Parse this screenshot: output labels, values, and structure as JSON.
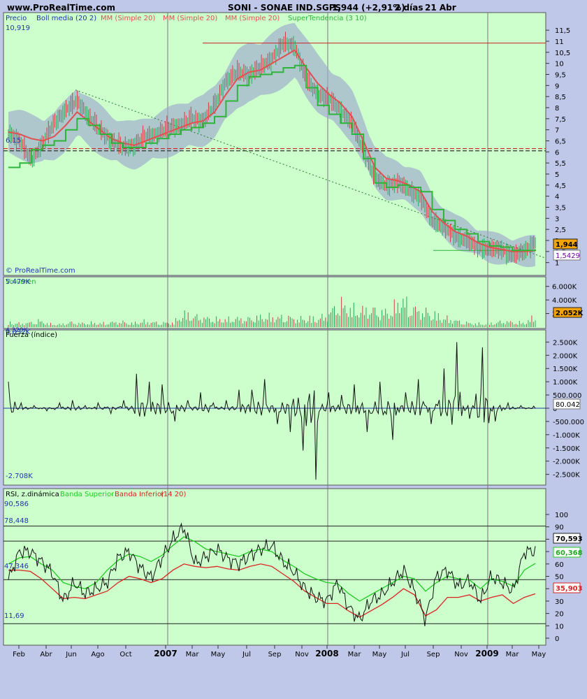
{
  "header": {
    "site": "www.ProRealTime.com",
    "ticker": "SONI - SONAE IND.SGPS",
    "quote": "1,944 (+2,91%)",
    "period": "2 días",
    "date": "21 Abr"
  },
  "colors": {
    "panel_bg": "#ccffcc",
    "page_bg": "#bfc8e9",
    "candle_up": "#27a85a",
    "candle_down": "#d23c46",
    "mm": "#e05050",
    "supertrend": "#2fb43a",
    "boll_band": "#9ea9cc",
    "rsi_line": "#111111",
    "band_superior": "#22cc22",
    "band_inferior": "#dd2222"
  },
  "watermark": "© ProRealTime.com",
  "x_axis_labels": [
    "Feb",
    "Abr",
    "Jun",
    "Ago",
    "Oct",
    "2007",
    "Mar",
    "May",
    "Jul",
    "Sep",
    "Nov",
    "2008",
    "Mar",
    "May",
    "Jul",
    "Sep",
    "Nov",
    "2009",
    "Mar",
    "May"
  ],
  "price_panel": {
    "legend": [
      "Precio",
      "Boll media (20 2)",
      "MM (Simple 20)",
      "MM (Simple 20)",
      "MM (Simple 20)",
      "SuperTendencia (3 10)"
    ],
    "hi_label": "10,919",
    "ref_label": "6,15",
    "last_tag": "1,944",
    "boll_tag": "1,5429",
    "axis_ticks": [
      "11,5",
      "11",
      "10,5",
      "10",
      "9,5",
      "9",
      "8,5",
      "8",
      "7,5",
      "7",
      "6,5",
      "6",
      "5,5",
      "5",
      "4,5",
      "4",
      "3,5",
      "3",
      "2,5",
      "2",
      "1,5",
      "1"
    ]
  },
  "volume_panel": {
    "title": "Volumen",
    "hi_label": "5.479K",
    "lo_label": "0.032K",
    "last_tag": "2.052K",
    "axis_ticks": [
      "6.000K",
      "4.000K",
      "2.000K"
    ]
  },
  "force_panel": {
    "title": "Fuerza (índice)",
    "top_label": "4.329K",
    "lo_label": "-2.708K",
    "last_tag": "80.042",
    "axis_ticks": [
      "2.500K",
      "2.000K",
      "1.500K",
      "1.000K",
      "500.000",
      "0",
      "-500.000",
      "-1.000K",
      "-1.500K",
      "-2.000K",
      "-2.500K"
    ]
  },
  "rsi_panel": {
    "title_rsi": "RSI, z.dinámica",
    "title_sup": "Banda Superior",
    "title_inf": "Banda Inferior",
    "title_params": "(14 20)",
    "left_labels": [
      "90,586",
      "78,448",
      "47,346",
      "11,69"
    ],
    "tags": [
      "70,593",
      "60,368",
      "35,903"
    ],
    "axis_ticks": [
      "100",
      "90",
      "80",
      "70",
      "60",
      "50",
      "40",
      "30",
      "20",
      "10",
      "0"
    ]
  },
  "chart_data": [
    {
      "type": "line",
      "name": "price",
      "x_range": [
        "2006-01",
        "2009-05"
      ],
      "ylim": [
        0.8,
        11.6
      ],
      "resistance_level": 10.919,
      "support_level": 6.15,
      "support_level_2": 6.05,
      "candles_close_approx": [
        6.9,
        6.5,
        5.6,
        6.4,
        7.3,
        7.9,
        8.3,
        7.6,
        7.0,
        6.5,
        6.2,
        6.3,
        6.7,
        6.8,
        7.1,
        7.2,
        7.5,
        7.4,
        8.1,
        9.2,
        9.6,
        9.5,
        9.8,
        10.2,
        10.9,
        10.8,
        9.3,
        8.6,
        8.4,
        7.9,
        7.3,
        6.1,
        4.8,
        4.5,
        4.6,
        4.3,
        3.9,
        2.9,
        2.6,
        2.2,
        2.0,
        1.7,
        1.6,
        1.6,
        1.3,
        1.5,
        1.94
      ],
      "mm": [
        6.9,
        6.8,
        6.6,
        6.5,
        6.7,
        7.2,
        7.8,
        7.4,
        7.0,
        6.6,
        6.4,
        6.3,
        6.5,
        6.7,
        6.9,
        7.1,
        7.3,
        7.4,
        7.8,
        8.6,
        9.3,
        9.6,
        9.7,
        10.0,
        10.3,
        10.6,
        9.8,
        9.1,
        8.6,
        8.2,
        7.6,
        6.5,
        5.3,
        4.8,
        4.7,
        4.5,
        4.2,
        3.3,
        2.8,
        2.4,
        2.2,
        1.9,
        1.7,
        1.6,
        1.5,
        1.5,
        1.54
      ],
      "supertrend": [
        5.3,
        5.5,
        6.1,
        6.3,
        6.5,
        7.0,
        7.5,
        7.2,
        6.8,
        6.4,
        6.2,
        6.2,
        6.4,
        6.6,
        6.8,
        7.0,
        7.1,
        7.3,
        7.6,
        8.3,
        9.0,
        9.4,
        9.5,
        9.6,
        9.8,
        9.9,
        8.9,
        8.1,
        7.7,
        7.3,
        6.8,
        5.7,
        4.6,
        4.4,
        4.5,
        4.4,
        4.2,
        3.4,
        2.9,
        2.5,
        2.3,
        1.95,
        1.75,
        1.7,
        1.55,
        1.55,
        1.6
      ]
    },
    {
      "type": "bar",
      "name": "volume",
      "ylim": [
        0,
        7000
      ],
      "values_K": [
        900,
        700,
        800,
        1200,
        600,
        500,
        900,
        700,
        800,
        700,
        900,
        1000,
        700,
        1100,
        900,
        800,
        900,
        2500,
        2000,
        1700,
        1500,
        1400,
        1600,
        1500,
        1800,
        2000,
        1800,
        1900,
        1500,
        1700,
        1600,
        2400,
        4600,
        3500,
        3100,
        3400,
        2800,
        2900,
        5300,
        3600,
        3000,
        2600,
        1800,
        1400,
        900,
        700,
        600,
        800,
        1100,
        900,
        800,
        2052
      ]
    },
    {
      "type": "line",
      "name": "force_index",
      "ylim": [
        -2800,
        2800
      ],
      "spikes_K": [
        1000,
        200,
        100,
        -100,
        200,
        300,
        100,
        200,
        -200,
        300,
        1300,
        1000,
        900,
        -500,
        300,
        600,
        200,
        300,
        700,
        1100,
        -600,
        -900,
        -1600,
        -2700,
        600,
        500,
        900,
        -900,
        1000,
        -1200,
        600,
        1100,
        -600,
        1500,
        2500,
        -400,
        2300,
        -500,
        200,
        100,
        80
      ],
      "last": 80.042
    },
    {
      "type": "line",
      "name": "rsi",
      "ylim": [
        0,
        100
      ],
      "reference_levels": [
        90.586,
        78.448,
        47.346,
        11.69
      ],
      "rsi": [
        47,
        70,
        70,
        62,
        53,
        30,
        45,
        36,
        40,
        45,
        65,
        70,
        57,
        49,
        65,
        80,
        90,
        60,
        66,
        72,
        64,
        60,
        67,
        72,
        75,
        62,
        54,
        40,
        33,
        30,
        45,
        25,
        15,
        30,
        35,
        45,
        55,
        38,
        15,
        50,
        55,
        42,
        47,
        30,
        50,
        45,
        38,
        70,
        70.593
      ],
      "band_superior": [
        60,
        65,
        66,
        60,
        55,
        45,
        42,
        40,
        45,
        55,
        63,
        68,
        66,
        62,
        67,
        75,
        82,
        78,
        72,
        70,
        68,
        66,
        70,
        72,
        70,
        63,
        58,
        52,
        48,
        45,
        44,
        36,
        30,
        35,
        40,
        45,
        50,
        48,
        38,
        45,
        50,
        48,
        47,
        40,
        48,
        46,
        42,
        55,
        60.368
      ],
      "band_inferior": [
        55,
        55,
        54,
        48,
        40,
        32,
        33,
        32,
        35,
        38,
        45,
        50,
        48,
        45,
        48,
        55,
        60,
        58,
        57,
        58,
        56,
        55,
        58,
        60,
        58,
        52,
        46,
        38,
        33,
        28,
        28,
        22,
        17,
        22,
        27,
        33,
        40,
        35,
        18,
        23,
        33,
        33,
        35,
        30,
        33,
        35,
        28,
        33,
        35.903
      ]
    }
  ]
}
